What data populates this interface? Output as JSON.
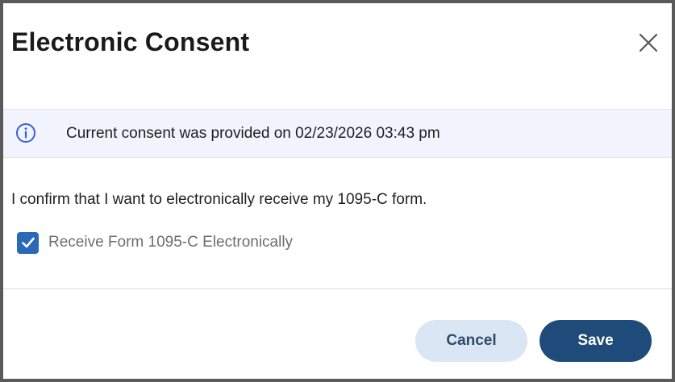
{
  "dialog": {
    "title": "Electronic Consent",
    "close_icon": "close-icon"
  },
  "info_banner": {
    "icon": "info-icon",
    "text": "Current consent was provided on 02/23/2026 03:43 pm",
    "icon_color": "#3b5fd6",
    "background": "#f1f3fd"
  },
  "body": {
    "confirm_text": "I confirm that I want to electronically receive my 1095-C form."
  },
  "checkbox": {
    "label": "Receive Form 1095-C Electronically",
    "checked": true,
    "color": "#2a69b7"
  },
  "footer": {
    "cancel_label": "Cancel",
    "save_label": "Save",
    "save_color": "#1f4b7a",
    "cancel_color": "#dbe6f5"
  }
}
